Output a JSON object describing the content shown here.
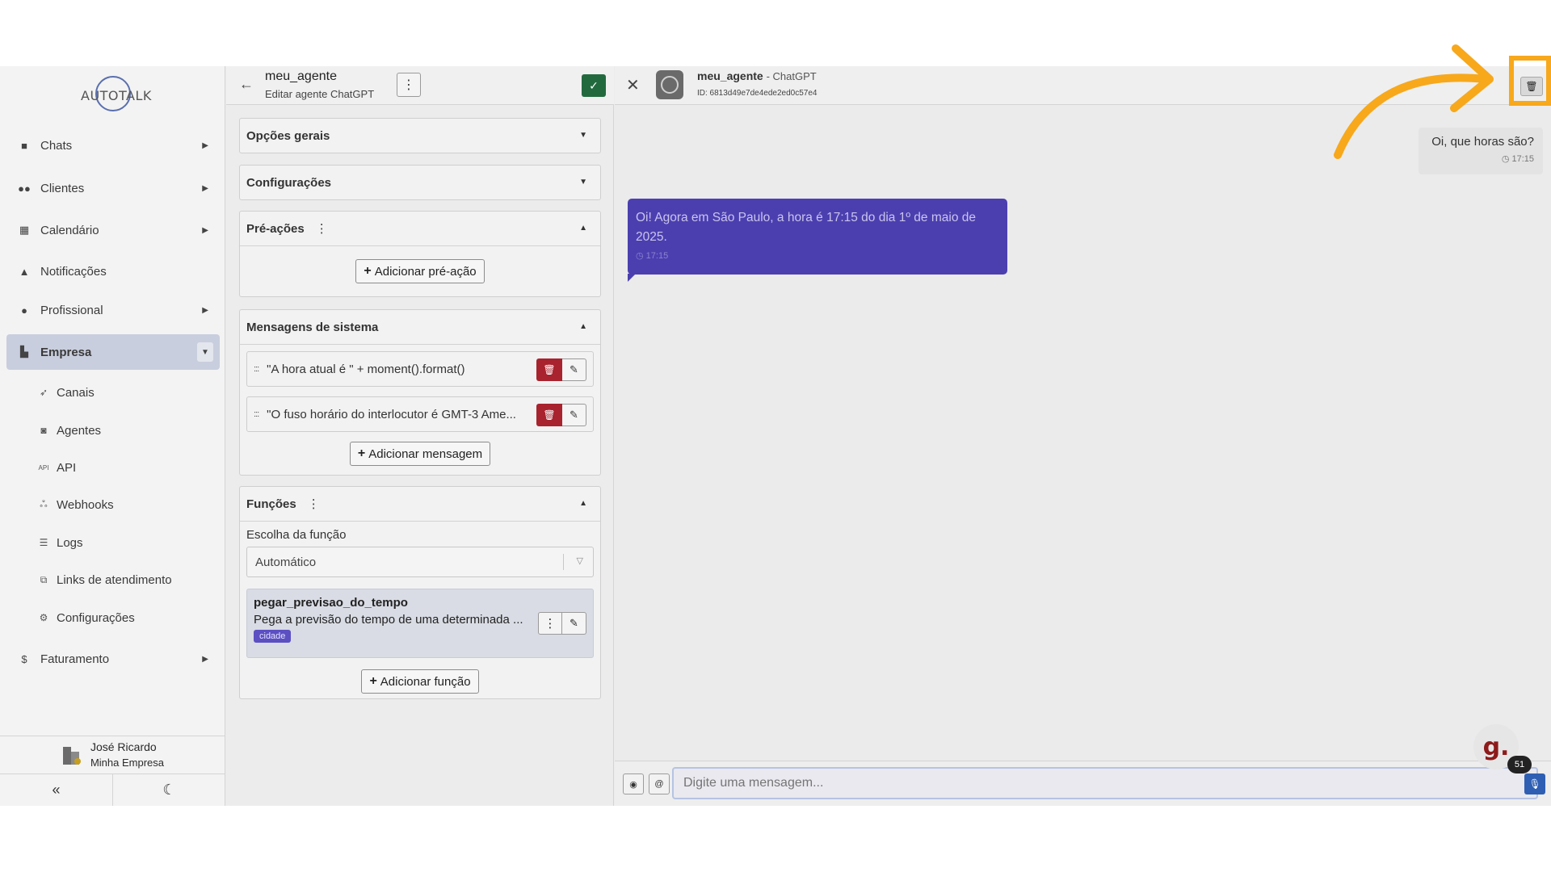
{
  "brand": {
    "logo_text": "AUTOTALK"
  },
  "sidebar": {
    "items": [
      {
        "label": "Chats",
        "icon": "chat-bubble-icon"
      },
      {
        "label": "Clientes",
        "icon": "users-icon"
      },
      {
        "label": "Calendário",
        "icon": "calendar-icon"
      },
      {
        "label": "Notificações",
        "icon": "bell-icon"
      },
      {
        "label": "Profissional",
        "icon": "user-tie-icon"
      },
      {
        "label": "Empresa",
        "icon": "building-icon"
      }
    ],
    "subitems": [
      {
        "label": "Canais",
        "icon": "rocket-icon"
      },
      {
        "label": "Agentes",
        "icon": "robot-icon"
      },
      {
        "label": "API",
        "icon": "api-icon"
      },
      {
        "label": "Webhooks",
        "icon": "webhook-icon"
      },
      {
        "label": "Logs",
        "icon": "list-icon"
      },
      {
        "label": "Links de atendimento",
        "icon": "external-link-icon"
      },
      {
        "label": "Configurações",
        "icon": "gear-icon"
      }
    ],
    "billing": {
      "label": "Faturamento",
      "icon": "dollar-icon"
    },
    "user": {
      "name": "José Ricardo",
      "company": "Minha Empresa"
    }
  },
  "editor": {
    "title": "meu_agente",
    "subtitle": "Editar agente ChatGPT",
    "sections": {
      "general": "Opções gerais",
      "settings": "Configurações",
      "pre_actions": "Pré-ações",
      "system_messages": "Mensagens de sistema",
      "functions": "Funções"
    },
    "add_pre_action": "Adicionar pré-ação",
    "system_messages": [
      "\"A hora atual é \" + moment().format()",
      "\"O fuso horário do interlocutor é GMT-3 Ame..."
    ],
    "add_message": "Adicionar mensagem",
    "function_choice_label": "Escolha da função",
    "function_choice_value": "Automático",
    "function": {
      "name": "pegar_previsao_do_tempo",
      "description": "Pega a previsão do tempo de uma determinada ...",
      "param": "cidade"
    },
    "add_function": "Adicionar função"
  },
  "chat": {
    "agent_name": "meu_agente",
    "agent_type": "ChatGPT",
    "agent_id": "ID: 6813d49e7de4ede2ed0c57e4",
    "messages": [
      {
        "direction": "out",
        "text": "Oi, que horas são?",
        "time": "17:15"
      },
      {
        "direction": "in",
        "text": "Oi! Agora em São Paulo, a hora é 17:15 do dia 1º de maio de 2025.",
        "time": "17:15"
      }
    ],
    "input_placeholder": "Digite uma mensagem...",
    "floating_badge_count": "51",
    "floating_letter": "g."
  },
  "colors": {
    "accent_purple": "#4b3fb0",
    "danger": "#a8232e",
    "success": "#226a3e",
    "annotation": "#f7a81b"
  }
}
